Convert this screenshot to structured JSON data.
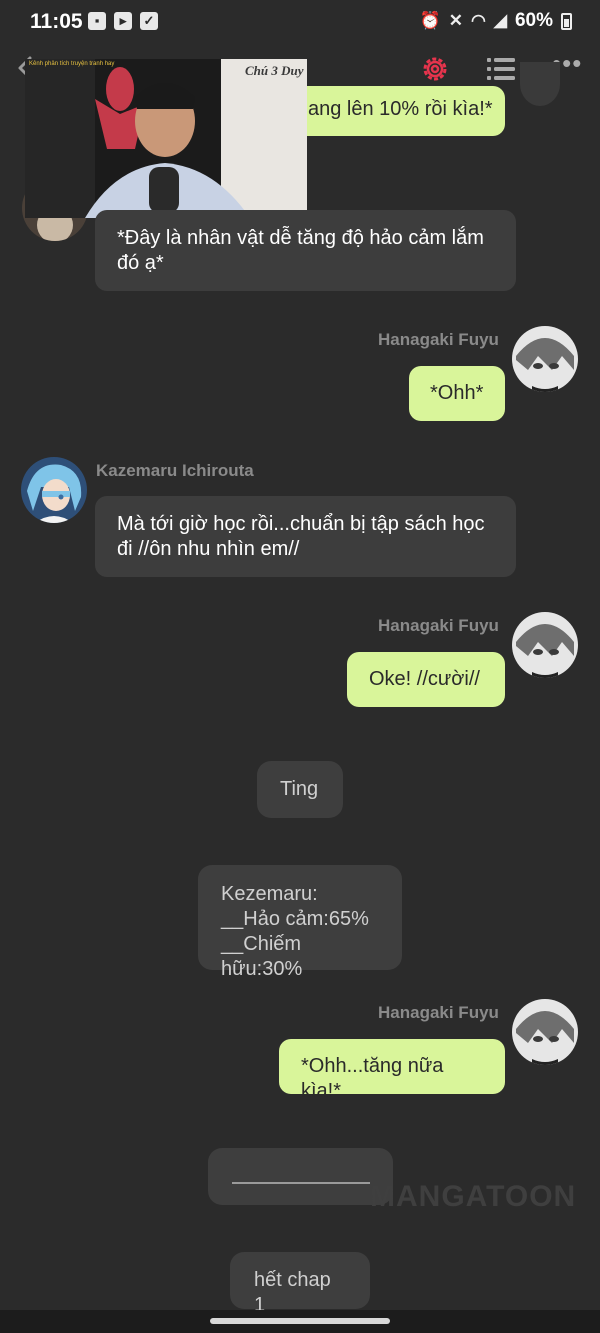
{
  "status_bar": {
    "time": "11:05",
    "battery": "60%",
    "signal_glyph": "◢"
  },
  "video": {
    "caption": "Kênh phân tích truyện tranh hay",
    "logo": "Chú 3 Duy"
  },
  "messages": {
    "m0_me_partial": "ang lên 10% rồi kìa!*",
    "m1_other": "*Đây là nhân vật dễ tăng độ hảo cảm lắm đó ạ*",
    "m2_sender": "Hanagaki Fuyu",
    "m2_me": "*Ohh*",
    "m3_sender": "Kazemaru Ichirouta",
    "m3_other": "Mà tới giờ học rồi...chuẩn bị tập sách học đi //ôn nhu nhìn em//",
    "m4_sender": "Hanagaki Fuyu",
    "m4_me": "Oke! //cười//",
    "m5_system": "Ting",
    "m6_system_line1": "Kezemaru:",
    "m6_system_line2": "__Hảo cảm:65%",
    "m6_system_line3": "__Chiếm hữu:30%",
    "m7_sender": "Hanagaki Fuyu",
    "m7_me": "*Ohh...tăng nữa kìa!*",
    "m9_system": "hết chap 1"
  },
  "watermark": "MANGATOON",
  "colors": {
    "background": "#2b2b2b",
    "bubble_me": "#d9f59a",
    "bubble_other": "#3d3d3d",
    "accent_gear": "#e8344d"
  }
}
